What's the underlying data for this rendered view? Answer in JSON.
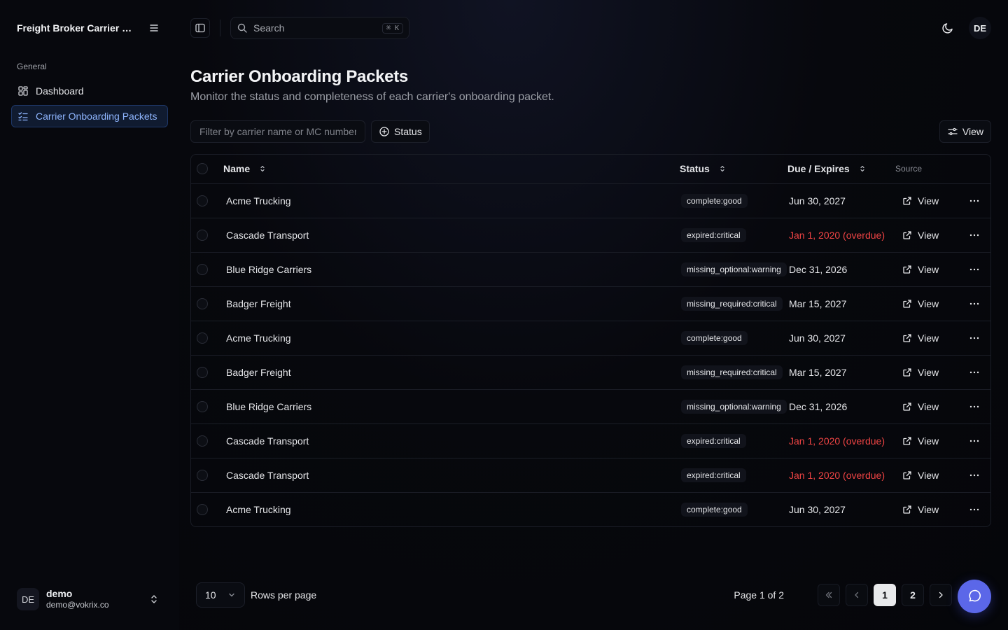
{
  "app": {
    "title": "Freight Broker Carrier O..."
  },
  "sidebar": {
    "group_label": "General",
    "items": [
      {
        "label": "Dashboard",
        "icon": "grid-icon",
        "active": false
      },
      {
        "label": "Carrier Onboarding Packets",
        "icon": "list-checks-icon",
        "active": true
      }
    ]
  },
  "user": {
    "initials": "DE",
    "name": "demo",
    "email": "demo@vokrix.co"
  },
  "topbar": {
    "search_placeholder": "Search",
    "search_shortcut": "⌘ K",
    "avatar_initials": "DE"
  },
  "page": {
    "title": "Carrier Onboarding Packets",
    "subtitle": "Monitor the status and completeness of each carrier's onboarding packet."
  },
  "toolbar": {
    "filter_placeholder": "Filter by carrier name or MC number...",
    "status_label": "Status",
    "view_label": "View"
  },
  "table": {
    "columns": {
      "name": "Name",
      "status": "Status",
      "due": "Due / Expires",
      "source": "Source"
    },
    "rows": [
      {
        "name": "Acme Trucking",
        "status": "complete:good",
        "due": "Jun 30, 2027",
        "overdue": false,
        "source": "View"
      },
      {
        "name": "Cascade Transport",
        "status": "expired:critical",
        "due": "Jan 1, 2020 (overdue)",
        "overdue": true,
        "source": "View"
      },
      {
        "name": "Blue Ridge Carriers",
        "status": "missing_optional:warning",
        "due": "Dec 31, 2026",
        "overdue": false,
        "source": "View"
      },
      {
        "name": "Badger Freight",
        "status": "missing_required:critical",
        "due": "Mar 15, 2027",
        "overdue": false,
        "source": "View"
      },
      {
        "name": "Acme Trucking",
        "status": "complete:good",
        "due": "Jun 30, 2027",
        "overdue": false,
        "source": "View"
      },
      {
        "name": "Badger Freight",
        "status": "missing_required:critical",
        "due": "Mar 15, 2027",
        "overdue": false,
        "source": "View"
      },
      {
        "name": "Blue Ridge Carriers",
        "status": "missing_optional:warning",
        "due": "Dec 31, 2026",
        "overdue": false,
        "source": "View"
      },
      {
        "name": "Cascade Transport",
        "status": "expired:critical",
        "due": "Jan 1, 2020 (overdue)",
        "overdue": true,
        "source": "View"
      },
      {
        "name": "Cascade Transport",
        "status": "expired:critical",
        "due": "Jan 1, 2020 (overdue)",
        "overdue": true,
        "source": "View"
      },
      {
        "name": "Acme Trucking",
        "status": "complete:good",
        "due": "Jun 30, 2027",
        "overdue": false,
        "source": "View"
      }
    ]
  },
  "pagination": {
    "rows_per_page_value": "10",
    "rows_per_page_label": "Rows per page",
    "page_info": "Page 1 of 2",
    "pages": [
      "1",
      "2"
    ],
    "current_page": "1"
  },
  "colors": {
    "accent": "#8fb6ff",
    "overdue": "#ef4444",
    "chat_fab": "#5b67e8"
  }
}
